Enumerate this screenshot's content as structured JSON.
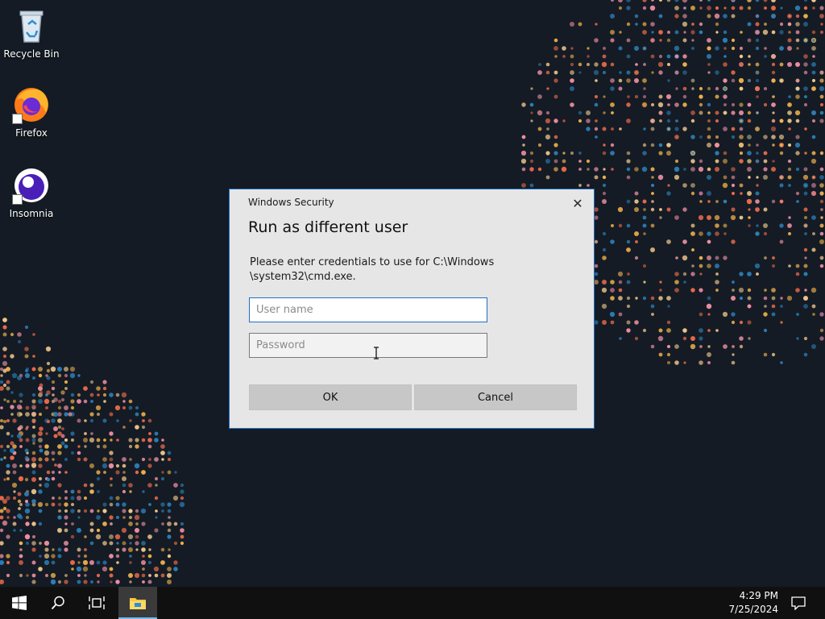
{
  "desktop": {
    "icons": [
      {
        "label": "Recycle Bin",
        "icon": "recycle-bin-icon"
      },
      {
        "label": "Firefox",
        "icon": "firefox-icon"
      },
      {
        "label": "Insomnia",
        "icon": "insomnia-icon"
      }
    ]
  },
  "dialog": {
    "caption": "Windows Security",
    "close_glyph": "✕",
    "title": "Run as different user",
    "message": "Please enter credentials to use for C:\\Windows \\system32\\cmd.exe.",
    "username": {
      "placeholder": "User name",
      "value": ""
    },
    "password": {
      "placeholder": "Password",
      "value": ""
    },
    "ok_label": "OK",
    "cancel_label": "Cancel"
  },
  "taskbar": {
    "time": "4:29 PM",
    "date": "7/25/2024",
    "items": [
      "start-icon",
      "search-icon",
      "task-view-icon",
      "file-explorer-icon",
      "notification-icon"
    ]
  },
  "colors": {
    "desktop_bg": "#141b24",
    "accent": "#1f6fc7",
    "dots": [
      "#e96a4a",
      "#f2b24c",
      "#ef8fa3",
      "#2c7fb8",
      "#f3c98b"
    ]
  }
}
